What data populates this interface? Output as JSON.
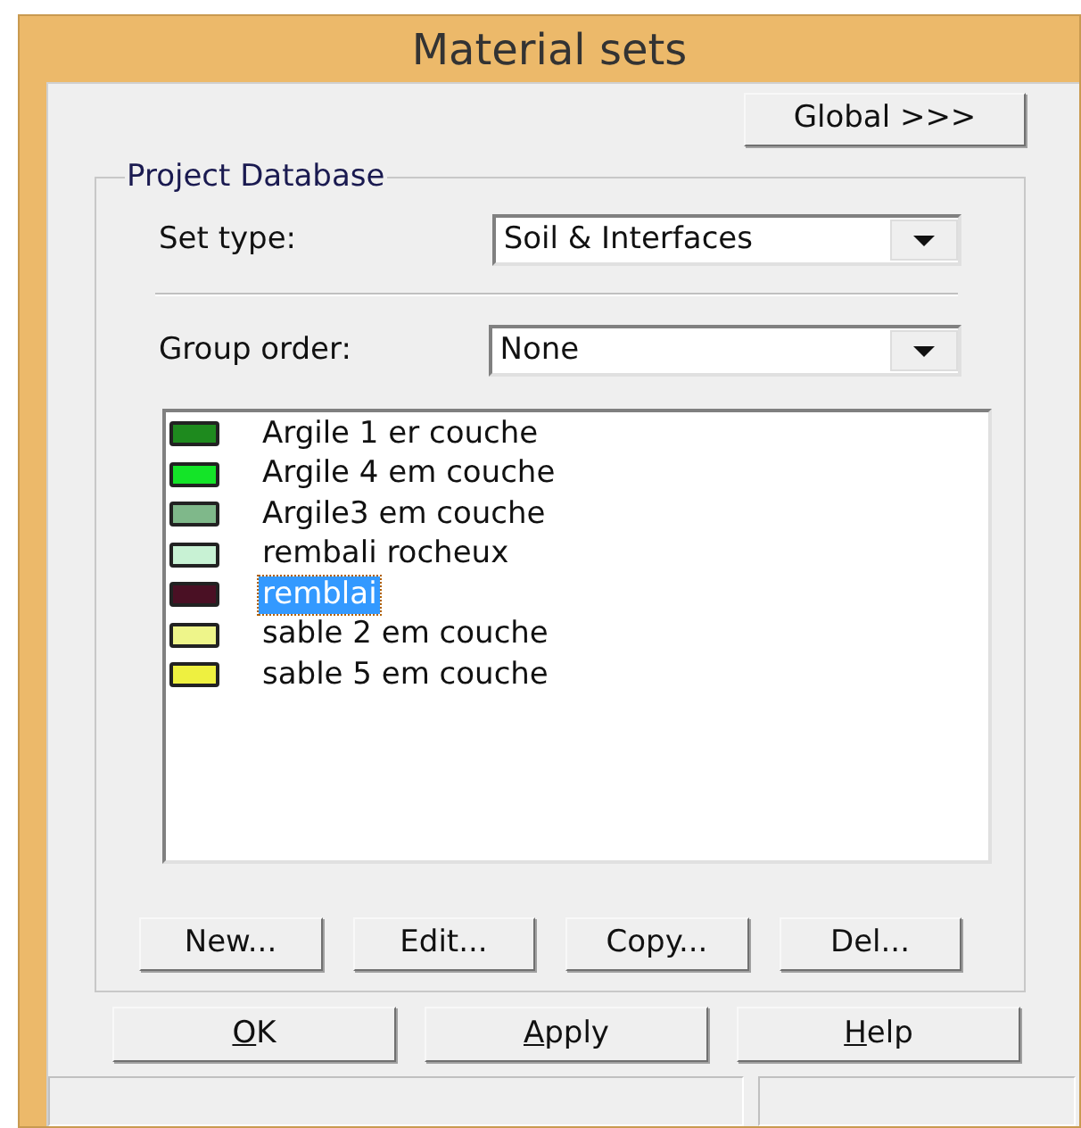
{
  "window": {
    "title": "Material sets"
  },
  "global_button": {
    "label": "Global >>>"
  },
  "group": {
    "title": "Project Database",
    "set_type": {
      "label": "Set type:",
      "value": "Soil & Interfaces"
    },
    "group_order": {
      "label": "Group order:",
      "value": "None"
    },
    "materials": [
      {
        "name": "Argile 1 er couche",
        "color": "#1e8a1e",
        "selected": false
      },
      {
        "name": "Argile 4 em couche",
        "color": "#14e428",
        "selected": false
      },
      {
        "name": "Argile3 em couche",
        "color": "#7fb88a",
        "selected": false
      },
      {
        "name": "rembali rocheux",
        "color": "#c8f2d4",
        "selected": false
      },
      {
        "name": "remblai",
        "color": "#4a1024",
        "selected": true
      },
      {
        "name": "sable 2 em couche",
        "color": "#eef58a",
        "selected": false
      },
      {
        "name": "sable 5 em couche",
        "color": "#eef040",
        "selected": false
      }
    ],
    "buttons": [
      {
        "label": "New..."
      },
      {
        "label": "Edit..."
      },
      {
        "label": "Copy..."
      },
      {
        "label": "Del..."
      }
    ]
  },
  "dialog_buttons": [
    {
      "label": "OK",
      "underline_first": true
    },
    {
      "label": "Apply",
      "underline_first": true
    },
    {
      "label": "Help",
      "underline_first": true
    }
  ]
}
